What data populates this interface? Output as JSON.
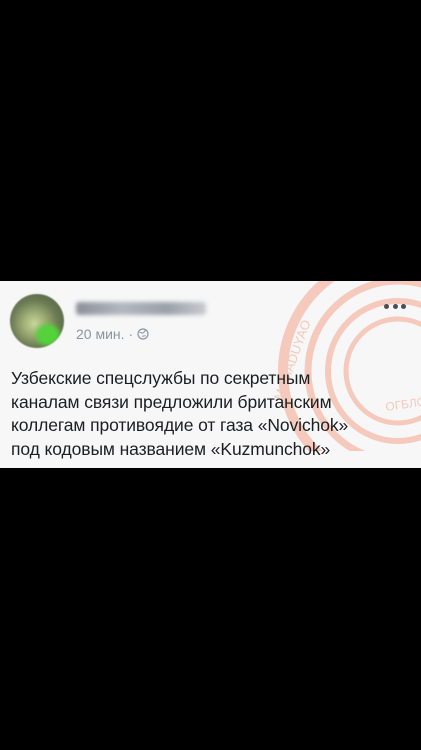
{
  "post": {
    "time": "20 мин.",
    "separator": "·",
    "text": "Узбекские спецслужбы по секретным\nканалам связи предложили британским\nколлегам противоядие от газа «Novichok»\nпод кодовым названием «Kuzmunchok»"
  },
  "icons": {
    "globe": "globe-icon",
    "more": "more-options-icon"
  },
  "watermark": {
    "text_top": "MAMADUYAO",
    "text_right": "ОГБЛО",
    "color": "#f4a58a"
  }
}
